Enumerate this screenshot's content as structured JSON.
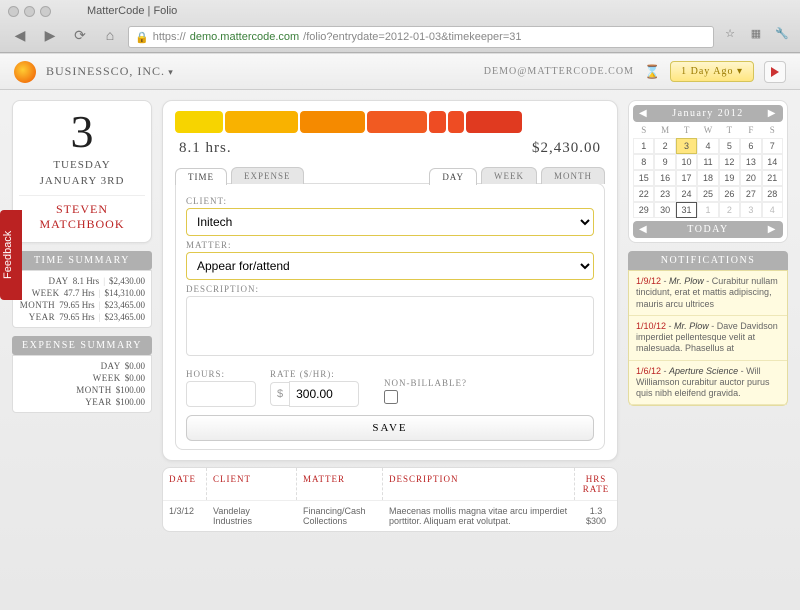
{
  "browser": {
    "tab_title": "MatterCode | Folio",
    "url_protocol": "https://",
    "url_host": "demo.mattercode.com",
    "url_path": "/folio?entrydate=2012-01-03&timekeeper=31"
  },
  "header": {
    "company": "BusinessCo, Inc.",
    "email": "demo@mattercode.com",
    "ago_label": "1 Day Ago ▾"
  },
  "feedback_label": "Feedback",
  "date_card": {
    "day_number": "3",
    "weekday": "Tuesday",
    "month_day": "January 3rd",
    "person_first": "Steven",
    "person_last": "Matchbook"
  },
  "time_summary": {
    "header": "Time Summary",
    "rows": [
      {
        "label": "Day",
        "hrs": "8.1 Hrs",
        "amt": "$2,430.00"
      },
      {
        "label": "Week",
        "hrs": "47.7 Hrs",
        "amt": "$14,310.00"
      },
      {
        "label": "Month",
        "hrs": "79.65 Hrs",
        "amt": "$23,465.00"
      },
      {
        "label": "Year",
        "hrs": "79.65 Hrs",
        "amt": "$23,465.00"
      }
    ]
  },
  "expense_summary": {
    "header": "Expense Summary",
    "rows": [
      {
        "label": "Day",
        "amt": "$0.00"
      },
      {
        "label": "Week",
        "amt": "$0.00"
      },
      {
        "label": "Month",
        "amt": "$100.00"
      },
      {
        "label": "Year",
        "amt": "$100.00"
      }
    ]
  },
  "totals": {
    "hours": "8.1 hrs.",
    "amount": "$2,430.00"
  },
  "bars": [
    {
      "w": 12,
      "c": "#f7d400"
    },
    {
      "w": 18,
      "c": "#f9b200"
    },
    {
      "w": 16,
      "c": "#f58a00"
    },
    {
      "w": 15,
      "c": "#f15a22"
    },
    {
      "w": 4,
      "c": "#ee4c23"
    },
    {
      "w": 4,
      "c": "#ee4c23"
    },
    {
      "w": 14,
      "c": "#e03a20"
    }
  ],
  "tabs1": [
    {
      "label": "Time",
      "active": true
    },
    {
      "label": "Expense",
      "active": false
    }
  ],
  "tabs2": [
    {
      "label": "Day",
      "active": true
    },
    {
      "label": "Week",
      "active": false
    },
    {
      "label": "Month",
      "active": false
    }
  ],
  "form": {
    "client_label": "Client:",
    "client_value": "Initech",
    "matter_label": "Matter:",
    "matter_value": "Appear for/attend",
    "description_label": "Description:",
    "description_value": "",
    "hours_label": "Hours:",
    "hours_value": "",
    "rate_label": "Rate ($/hr):",
    "rate_currency": "$",
    "rate_value": "300.00",
    "nonbillable_label": "Non-billable?",
    "save_label": "Save"
  },
  "log": {
    "columns": {
      "date": "Date",
      "client": "Client",
      "matter": "Matter",
      "desc": "Description",
      "hrs": "Hrs Rate"
    },
    "rows": [
      {
        "date": "1/3/12",
        "client": "Vandelay Industries",
        "matter": "Financing/Cash Collections",
        "desc": "Maecenas mollis magna vitae arcu imperdiet porttitor. Aliquam erat volutpat.",
        "hrs": "1.3",
        "rate": "$300"
      }
    ]
  },
  "calendar": {
    "title": "January 2012",
    "dow": [
      "S",
      "M",
      "T",
      "W",
      "T",
      "F",
      "S"
    ],
    "weeks": [
      [
        {
          "d": "1"
        },
        {
          "d": "2"
        },
        {
          "d": "3",
          "sel": true
        },
        {
          "d": "4"
        },
        {
          "d": "5"
        },
        {
          "d": "6"
        },
        {
          "d": "7"
        }
      ],
      [
        {
          "d": "8"
        },
        {
          "d": "9"
        },
        {
          "d": "10"
        },
        {
          "d": "11"
        },
        {
          "d": "12"
        },
        {
          "d": "13"
        },
        {
          "d": "14"
        }
      ],
      [
        {
          "d": "15"
        },
        {
          "d": "16"
        },
        {
          "d": "17"
        },
        {
          "d": "18"
        },
        {
          "d": "19"
        },
        {
          "d": "20"
        },
        {
          "d": "21"
        }
      ],
      [
        {
          "d": "22"
        },
        {
          "d": "23"
        },
        {
          "d": "24"
        },
        {
          "d": "25"
        },
        {
          "d": "26"
        },
        {
          "d": "27"
        },
        {
          "d": "28"
        }
      ],
      [
        {
          "d": "29"
        },
        {
          "d": "30"
        },
        {
          "d": "31",
          "today": true
        },
        {
          "d": "1",
          "other": true
        },
        {
          "d": "2",
          "other": true
        },
        {
          "d": "3",
          "other": true
        },
        {
          "d": "4",
          "other": true
        }
      ]
    ],
    "today_label": "Today"
  },
  "notifications": {
    "header": "Notifications",
    "items": [
      {
        "date": "1/9/12",
        "who": "Mr. Plow",
        "text": "Curabitur nullam tincidunt, erat et mattis adipiscing, mauris arcu ultrices"
      },
      {
        "date": "1/10/12",
        "who": "Mr. Plow",
        "text": "Dave Davidson imperdiet pellentesque velit at malesuada. Phasellus at"
      },
      {
        "date": "1/6/12",
        "who": "Aperture Science",
        "text": "Will Williamson curabitur auctor purus quis nibh eleifend gravida."
      }
    ]
  }
}
